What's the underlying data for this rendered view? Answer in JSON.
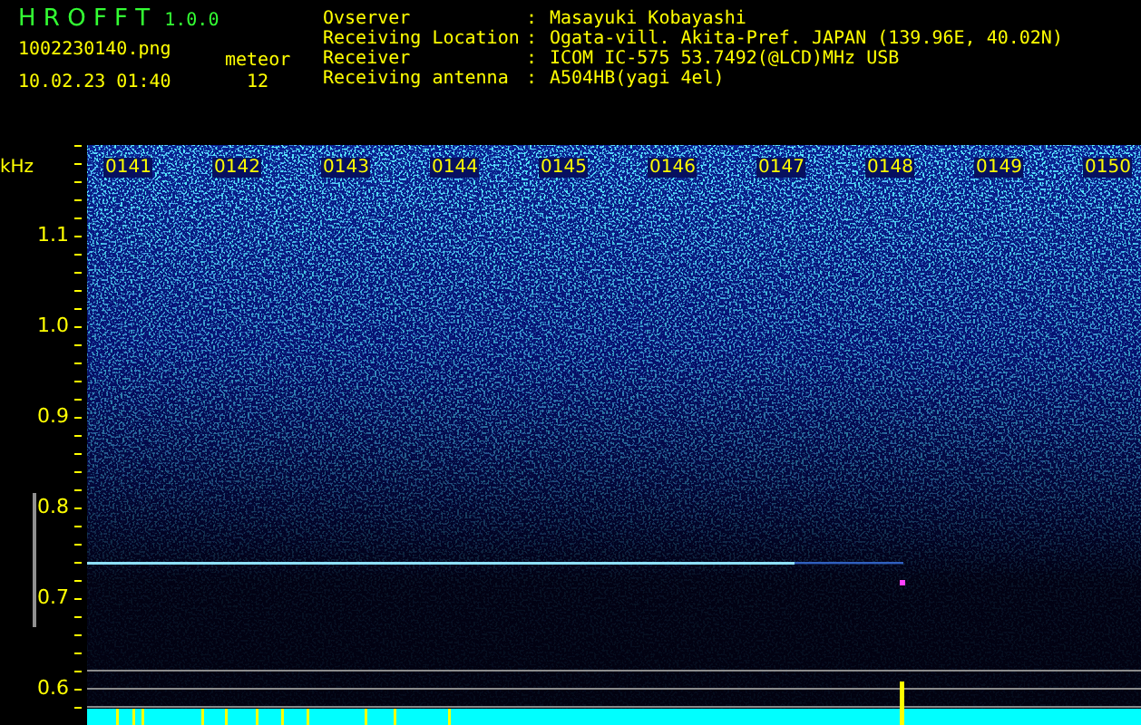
{
  "header": {
    "app_title": "H R O F F T",
    "version": "1.0.0",
    "file_name": "1002230140.png",
    "datetime": "10.02.23 01:40",
    "meteor_label": "meteor",
    "meteor_count": "12"
  },
  "station_info": [
    {
      "label": "Ovserver",
      "separator": ":",
      "value": "Masayuki Kobayashi"
    },
    {
      "label": "Receiving Location",
      "separator": ":",
      "value": "Ogata-vill. Akita-Pref. JAPAN (139.96E, 40.02N)"
    },
    {
      "label": "Receiver",
      "separator": ":",
      "value": "ICOM IC-575 53.7492(@LCD)MHz USB"
    },
    {
      "label": "Receiving antenna",
      "separator": ":",
      "value": "A504HB(yagi 4el)"
    }
  ],
  "spectrogram": {
    "y_unit": "kHz",
    "y_labels": [
      "1.1",
      "1.0",
      "0.9",
      "0.8",
      "0.7",
      "0.6"
    ],
    "time_labels": [
      "0141",
      "0142",
      "0143",
      "0144",
      "0145",
      "0146",
      "0147",
      "0148",
      "0149",
      "0150"
    ]
  }
}
